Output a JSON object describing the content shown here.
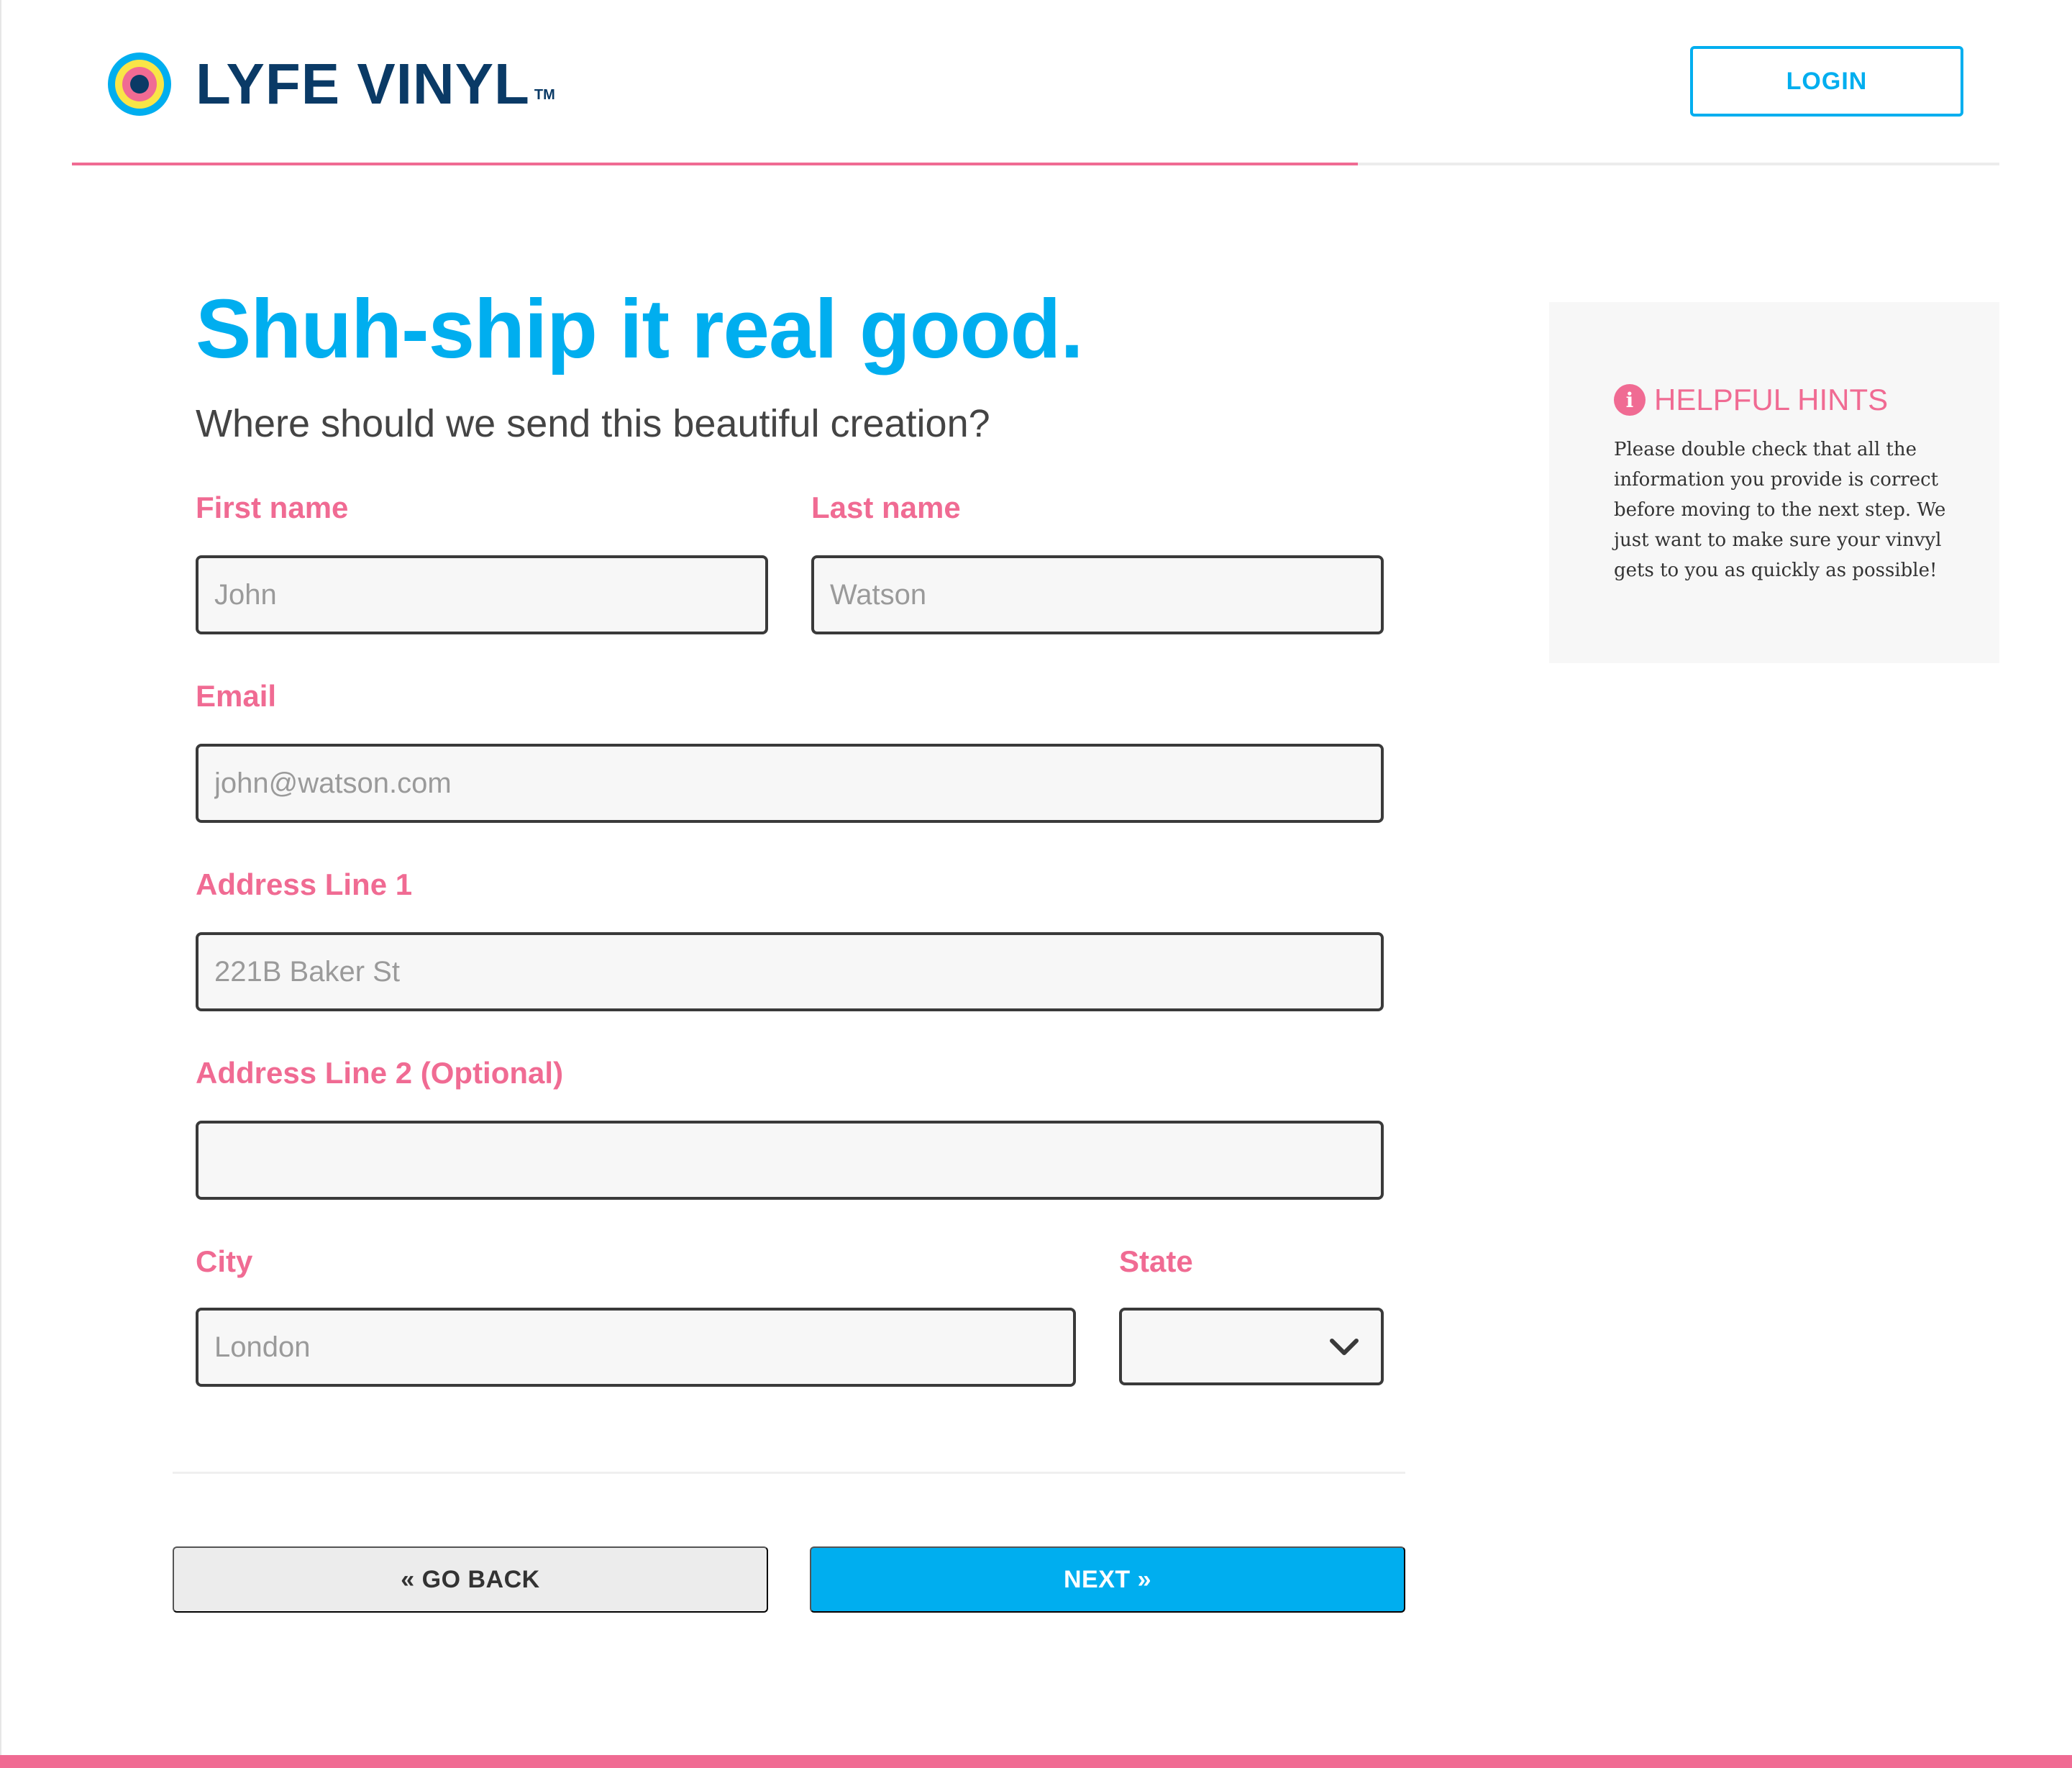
{
  "brand": {
    "name": "LYFE VINYL",
    "trademark": "TM",
    "colors": {
      "navy": "#0a3a66",
      "blue": "#00aeef",
      "pink": "#f06b93",
      "yellow": "#f9e547"
    }
  },
  "header": {
    "login_label": "LOGIN",
    "progress_fraction": 0.667
  },
  "main": {
    "title": "Shuh-ship it real good.",
    "subtitle": "Where should we send this beautiful creation?"
  },
  "form": {
    "first_name": {
      "label": "First name",
      "placeholder": "John",
      "value": ""
    },
    "last_name": {
      "label": "Last name",
      "placeholder": "Watson",
      "value": ""
    },
    "email": {
      "label": "Email",
      "placeholder": "john@watson.com",
      "value": ""
    },
    "address1": {
      "label": "Address Line 1",
      "placeholder": "221B Baker St",
      "value": ""
    },
    "address2": {
      "label": "Address Line 2 (Optional)",
      "placeholder": "",
      "value": ""
    },
    "city": {
      "label": "City",
      "placeholder": "London",
      "value": ""
    },
    "state": {
      "label": "State",
      "selected": "",
      "icon": "chevron-down-icon"
    }
  },
  "actions": {
    "back_label": "« GO BACK",
    "next_label": "NEXT »"
  },
  "hints": {
    "icon": "info-icon",
    "icon_glyph": "i",
    "title": "HELPFUL HINTS",
    "body": "Please double check that all the information you provide is correct before moving to the next step. We just want to make sure your vinvyl gets to you as quickly as possible!"
  }
}
